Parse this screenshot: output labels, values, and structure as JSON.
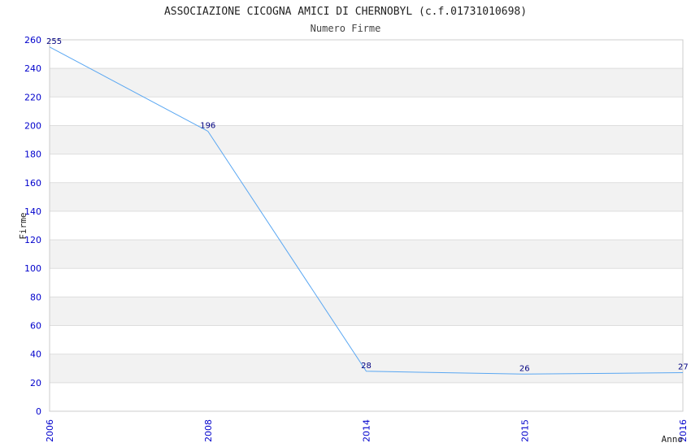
{
  "chart_data": {
    "type": "line",
    "title": "ASSOCIAZIONE CICOGNA AMICI DI CHERNOBYL (c.f.01731010698)",
    "subtitle": "Numero Firme",
    "xlabel": "Anno",
    "ylabel": "Firme",
    "categories": [
      "2006",
      "2008",
      "2014",
      "2015",
      "2016"
    ],
    "values": [
      255,
      196,
      28,
      26,
      27
    ],
    "data_labels": [
      "255",
      "196",
      "28",
      "26",
      "27"
    ],
    "yticks": [
      "0",
      "20",
      "40",
      "60",
      "80",
      "100",
      "120",
      "140",
      "160",
      "180",
      "200",
      "220",
      "240",
      "260"
    ],
    "ylim": [
      0,
      260
    ],
    "grid": true,
    "colors": {
      "line": "#5aa7f2",
      "band": "#f2f2f2",
      "grid": "#dddddd",
      "tick": "#0000cc",
      "label": "#000080"
    }
  }
}
